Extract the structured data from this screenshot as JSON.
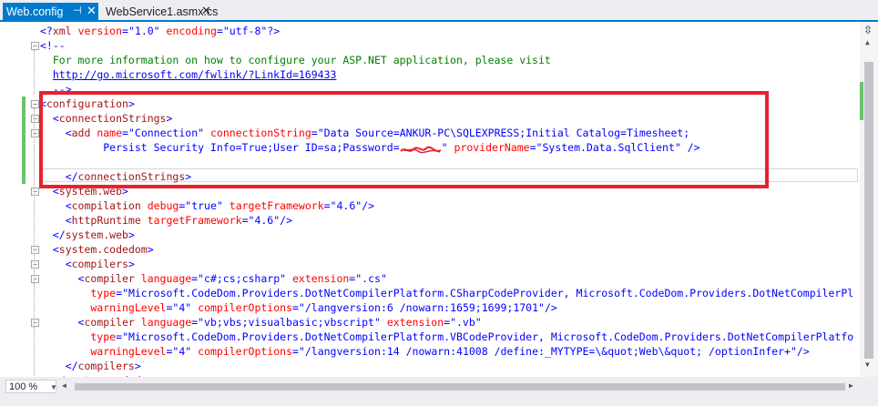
{
  "tabs": {
    "active": {
      "label": "Web.config",
      "pin_icon": "pin-icon",
      "close_glyph": "✕"
    },
    "inactive": {
      "label": "WebService1.asmx.cs",
      "close_glyph": "✕"
    }
  },
  "editor": {
    "zoom": "100 %",
    "colors": {
      "accent": "#007acc",
      "highlight": "#e8212e",
      "change_bar": "#6cc26c"
    },
    "lines": [
      [
        [
          "t-pun",
          "<?"
        ],
        [
          "t-tag",
          "xml "
        ],
        [
          "t-attr",
          "version"
        ],
        [
          "t-pun",
          "=\""
        ],
        [
          "t-val",
          "1.0"
        ],
        [
          "t-pun",
          "\" "
        ],
        [
          "t-attr",
          "encoding"
        ],
        [
          "t-pun",
          "=\""
        ],
        [
          "t-val",
          "utf-8"
        ],
        [
          "t-pun",
          "\"?>"
        ]
      ],
      [
        [
          "t-pun",
          "<!--"
        ]
      ],
      [
        [
          "t-com",
          "  For more information on how to configure your ASP.NET application, please visit"
        ]
      ],
      [
        [
          "t-com",
          "  "
        ],
        [
          "t-link",
          "http://go.microsoft.com/fwlink/?LinkId=169433"
        ]
      ],
      [
        [
          "t-pun",
          "  -->"
        ]
      ],
      [
        [
          "t-pun",
          "<"
        ],
        [
          "t-tag",
          "configuration"
        ],
        [
          "t-pun",
          ">"
        ]
      ],
      [
        [
          "t-pun",
          "  <"
        ],
        [
          "t-tag",
          "connectionStrings"
        ],
        [
          "t-pun",
          ">"
        ]
      ],
      [
        [
          "t-pun",
          "    <"
        ],
        [
          "t-tag",
          "add "
        ],
        [
          "t-attr",
          "name"
        ],
        [
          "t-pun",
          "=\""
        ],
        [
          "t-val",
          "Connection"
        ],
        [
          "t-pun",
          "\" "
        ],
        [
          "t-attr",
          "connectionString"
        ],
        [
          "t-pun",
          "=\""
        ],
        [
          "t-val",
          "Data Source=ANKUR-PC\\SQLEXPRESS;Initial Catalog=Timesheet;"
        ]
      ],
      [
        [
          "t-val",
          "          Persist Security Info=True;User ID=sa;Password="
        ],
        [
          "redact",
          ""
        ],
        [
          "t-pun",
          "\" "
        ],
        [
          "t-attr",
          "providerName"
        ],
        [
          "t-pun",
          "=\""
        ],
        [
          "t-val",
          "System.Data.SqlClient"
        ],
        [
          "t-pun",
          "\" />"
        ]
      ],
      [],
      [
        [
          "t-pun",
          "    </"
        ],
        [
          "t-tag",
          "connectionStrings"
        ],
        [
          "t-pun",
          ">"
        ]
      ],
      [
        [
          "t-pun",
          "  <"
        ],
        [
          "t-tag",
          "system.web"
        ],
        [
          "t-pun",
          ">"
        ]
      ],
      [
        [
          "t-pun",
          "    <"
        ],
        [
          "t-tag",
          "compilation "
        ],
        [
          "t-attr",
          "debug"
        ],
        [
          "t-pun",
          "=\""
        ],
        [
          "t-val",
          "true"
        ],
        [
          "t-pun",
          "\" "
        ],
        [
          "t-attr",
          "targetFramework"
        ],
        [
          "t-pun",
          "=\""
        ],
        [
          "t-val",
          "4.6"
        ],
        [
          "t-pun",
          "\"/>"
        ]
      ],
      [
        [
          "t-pun",
          "    <"
        ],
        [
          "t-tag",
          "httpRuntime "
        ],
        [
          "t-attr",
          "targetFramework"
        ],
        [
          "t-pun",
          "=\""
        ],
        [
          "t-val",
          "4.6"
        ],
        [
          "t-pun",
          "\"/>"
        ]
      ],
      [
        [
          "t-pun",
          "  </"
        ],
        [
          "t-tag",
          "system.web"
        ],
        [
          "t-pun",
          ">"
        ]
      ],
      [
        [
          "t-pun",
          "  <"
        ],
        [
          "t-tag",
          "system.codedom"
        ],
        [
          "t-pun",
          ">"
        ]
      ],
      [
        [
          "t-pun",
          "    <"
        ],
        [
          "t-tag",
          "compilers"
        ],
        [
          "t-pun",
          ">"
        ]
      ],
      [
        [
          "t-pun",
          "      <"
        ],
        [
          "t-tag",
          "compiler "
        ],
        [
          "t-attr",
          "language"
        ],
        [
          "t-pun",
          "=\""
        ],
        [
          "t-val",
          "c#;cs;csharp"
        ],
        [
          "t-pun",
          "\" "
        ],
        [
          "t-attr",
          "extension"
        ],
        [
          "t-pun",
          "=\""
        ],
        [
          "t-val",
          ".cs"
        ],
        [
          "t-pun",
          "\""
        ]
      ],
      [
        [
          "t-attr",
          "        type"
        ],
        [
          "t-pun",
          "=\""
        ],
        [
          "t-val",
          "Microsoft.CodeDom.Providers.DotNetCompilerPlatform.CSharpCodeProvider, Microsoft.CodeDom.Providers.DotNetCompilerPl"
        ]
      ],
      [
        [
          "t-attr",
          "        warningLevel"
        ],
        [
          "t-pun",
          "=\""
        ],
        [
          "t-val",
          "4"
        ],
        [
          "t-pun",
          "\" "
        ],
        [
          "t-attr",
          "compilerOptions"
        ],
        [
          "t-pun",
          "=\""
        ],
        [
          "t-val",
          "/langversion:6 /nowarn:1659;1699;1701"
        ],
        [
          "t-pun",
          "\"/>"
        ]
      ],
      [
        [
          "t-pun",
          "      <"
        ],
        [
          "t-tag",
          "compiler "
        ],
        [
          "t-attr",
          "language"
        ],
        [
          "t-pun",
          "=\""
        ],
        [
          "t-val",
          "vb;vbs;visualbasic;vbscript"
        ],
        [
          "t-pun",
          "\" "
        ],
        [
          "t-attr",
          "extension"
        ],
        [
          "t-pun",
          "=\""
        ],
        [
          "t-val",
          ".vb"
        ],
        [
          "t-pun",
          "\""
        ]
      ],
      [
        [
          "t-attr",
          "        type"
        ],
        [
          "t-pun",
          "=\""
        ],
        [
          "t-val",
          "Microsoft.CodeDom.Providers.DotNetCompilerPlatform.VBCodeProvider, Microsoft.CodeDom.Providers.DotNetCompilerPlatfo"
        ]
      ],
      [
        [
          "t-attr",
          "        warningLevel"
        ],
        [
          "t-pun",
          "=\""
        ],
        [
          "t-val",
          "4"
        ],
        [
          "t-pun",
          "\" "
        ],
        [
          "t-attr",
          "compilerOptions"
        ],
        [
          "t-pun",
          "=\""
        ],
        [
          "t-val",
          "/langversion:14 /nowarn:41008 /define:_MYTYPE=\\&quot;Web\\&quot; /optionInfer+"
        ],
        [
          "t-pun",
          "\"/>"
        ]
      ],
      [
        [
          "t-pun",
          "    </"
        ],
        [
          "t-tag",
          "compilers"
        ],
        [
          "t-pun",
          ">"
        ]
      ],
      [
        [
          "t-pun",
          "  </"
        ],
        [
          "t-tag",
          "system.codedom"
        ],
        [
          "t-pun",
          ">"
        ]
      ]
    ]
  }
}
